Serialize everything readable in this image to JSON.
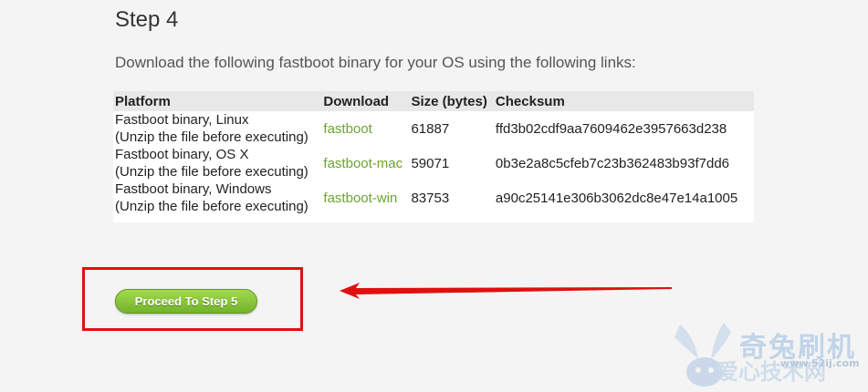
{
  "step_title": "Step 4",
  "instructions": "Download the following fastboot binary for your OS using the following links:",
  "table": {
    "headers": [
      "Platform",
      "Download",
      "Size (bytes)",
      "Checksum"
    ],
    "rows": [
      {
        "platform": "Fastboot binary, Linux",
        "note": "(Unzip the file before executing)",
        "download": "fastboot",
        "size": "61887",
        "checksum": "ffd3b02cdf9aa7609462e3957663d238"
      },
      {
        "platform": "Fastboot binary, OS X",
        "note": "(Unzip the file before executing)",
        "download": "fastboot-mac",
        "size": "59071",
        "checksum": "0b3e2a8c5cfeb7c23b362483b93f7dd6"
      },
      {
        "platform": "Fastboot binary, Windows",
        "note": "(Unzip the file before executing)",
        "download": "fastboot-win",
        "size": "83753",
        "checksum": "a90c25141e306b3062dc8e47e14a1005"
      }
    ]
  },
  "proceed_button": "Proceed To Step 5",
  "watermark": {
    "main": "奇兔刷机",
    "sub": "爱心技术网",
    "url": "www.52ij.com"
  },
  "colors": {
    "link": "#6aa52f",
    "button": "#8cc63f",
    "highlight": "#e01010",
    "background": "#f4f4f4"
  }
}
